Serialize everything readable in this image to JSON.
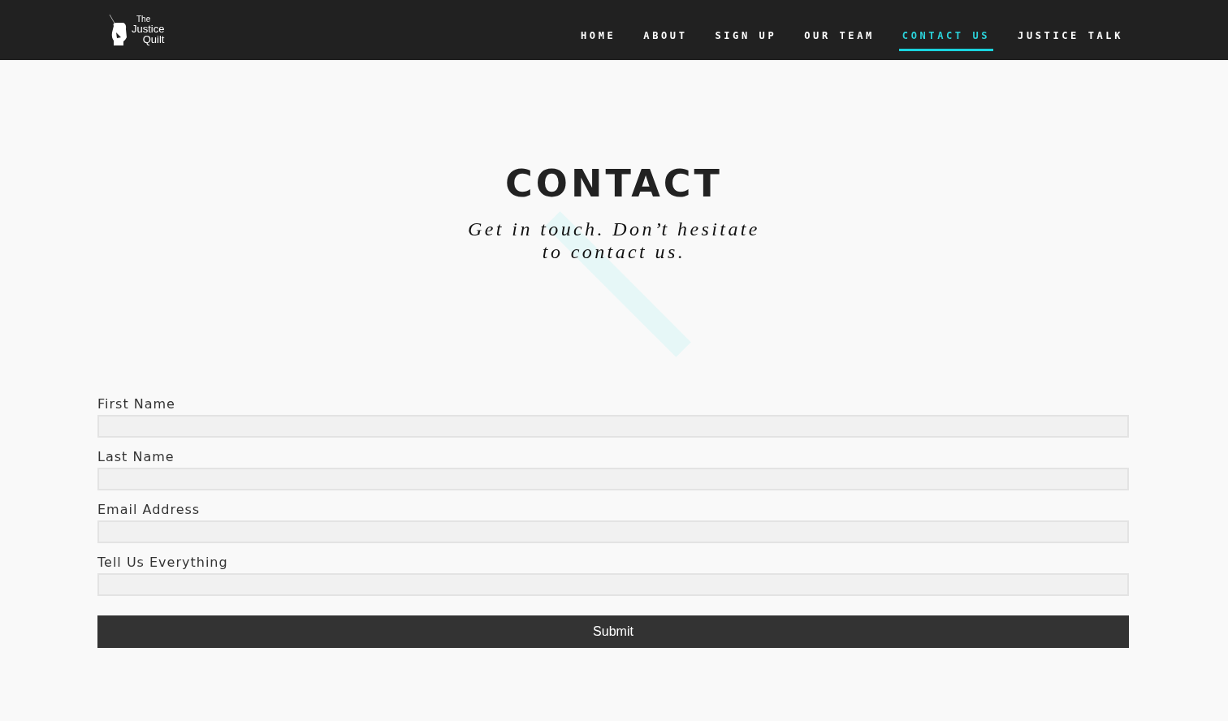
{
  "logo": {
    "lines": [
      "The",
      "Justice",
      "Quilt"
    ]
  },
  "nav": [
    {
      "label": "HOME",
      "selected": false
    },
    {
      "label": "ABOUT",
      "selected": false
    },
    {
      "label": "SIGN UP",
      "selected": false
    },
    {
      "label": "OUR TEAM",
      "selected": false
    },
    {
      "label": "CONTACT US",
      "selected": true
    },
    {
      "label": "JUSTICE TALK",
      "selected": false
    }
  ],
  "heading": "CONTACT",
  "subtitle": [
    "Get in touch. Don’t hesitate",
    "to contact us."
  ],
  "form": {
    "fields": [
      {
        "label": "First Name"
      },
      {
        "label": "Last Name"
      },
      {
        "label": "Email Address"
      },
      {
        "label": "Tell Us Everything"
      }
    ],
    "submit": "Submit"
  }
}
